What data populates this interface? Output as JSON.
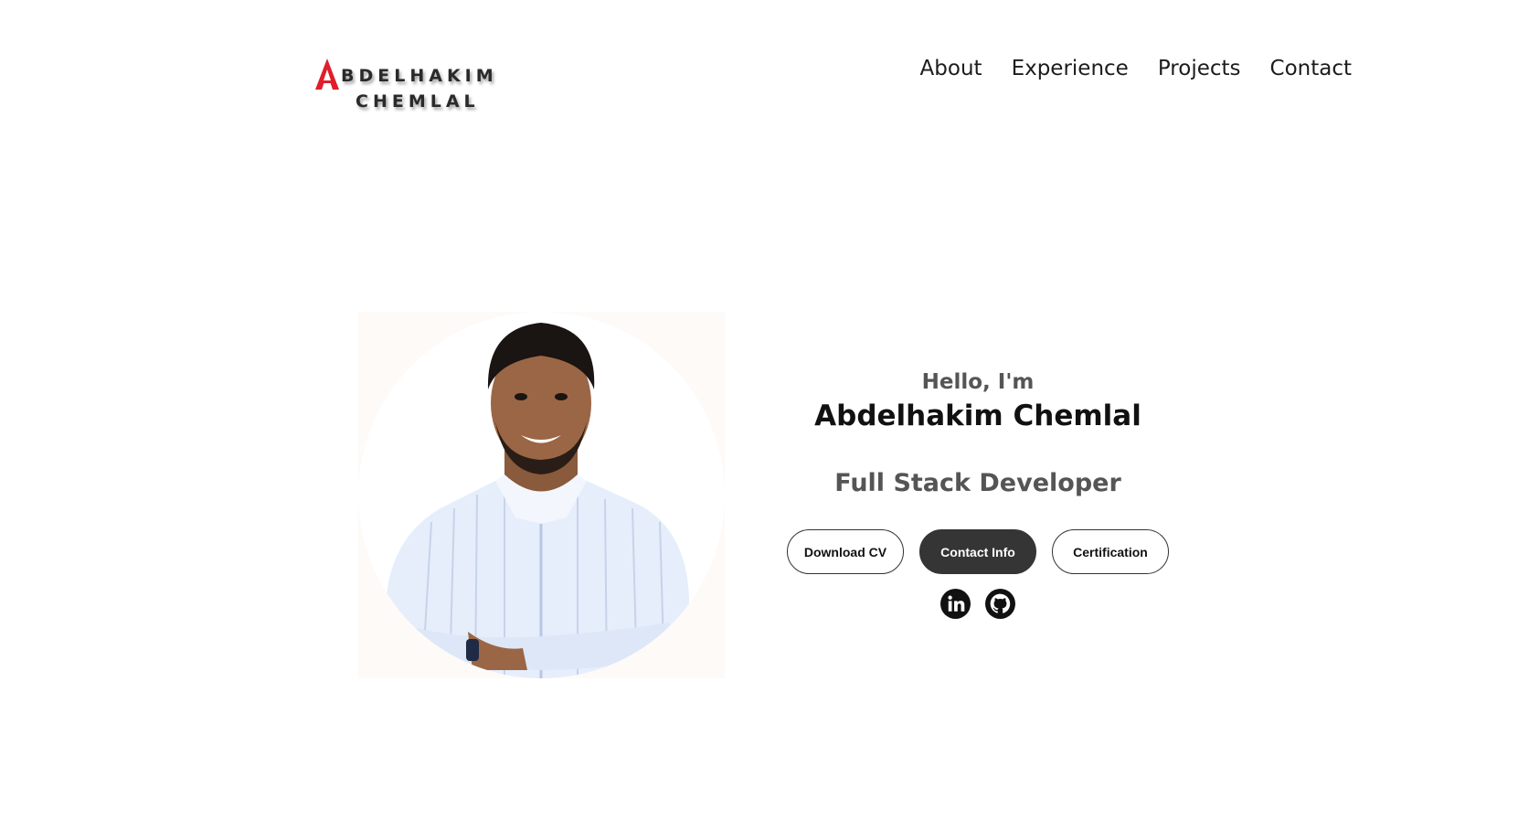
{
  "brand": {
    "logo_text_line1": "ABDELHAKIM",
    "logo_text_line2": "CHEMLAL",
    "line1_rest": "BDELHAKIM",
    "accent_color": "#e01e2c"
  },
  "nav": {
    "items": [
      {
        "label": "About"
      },
      {
        "label": "Experience"
      },
      {
        "label": "Projects"
      },
      {
        "label": "Contact"
      }
    ]
  },
  "hero": {
    "greeting": "Hello, I'm",
    "name": "Abdelhakim Chemlal",
    "title": "Full Stack Developer",
    "buttons": {
      "download_cv": "Download CV",
      "contact_info": "Contact Info",
      "certification": "Certification"
    },
    "socials": [
      {
        "icon": "linkedin-icon"
      },
      {
        "icon": "github-icon"
      }
    ]
  },
  "colors": {
    "dark_button": "#353535",
    "text_muted": "#555555"
  }
}
